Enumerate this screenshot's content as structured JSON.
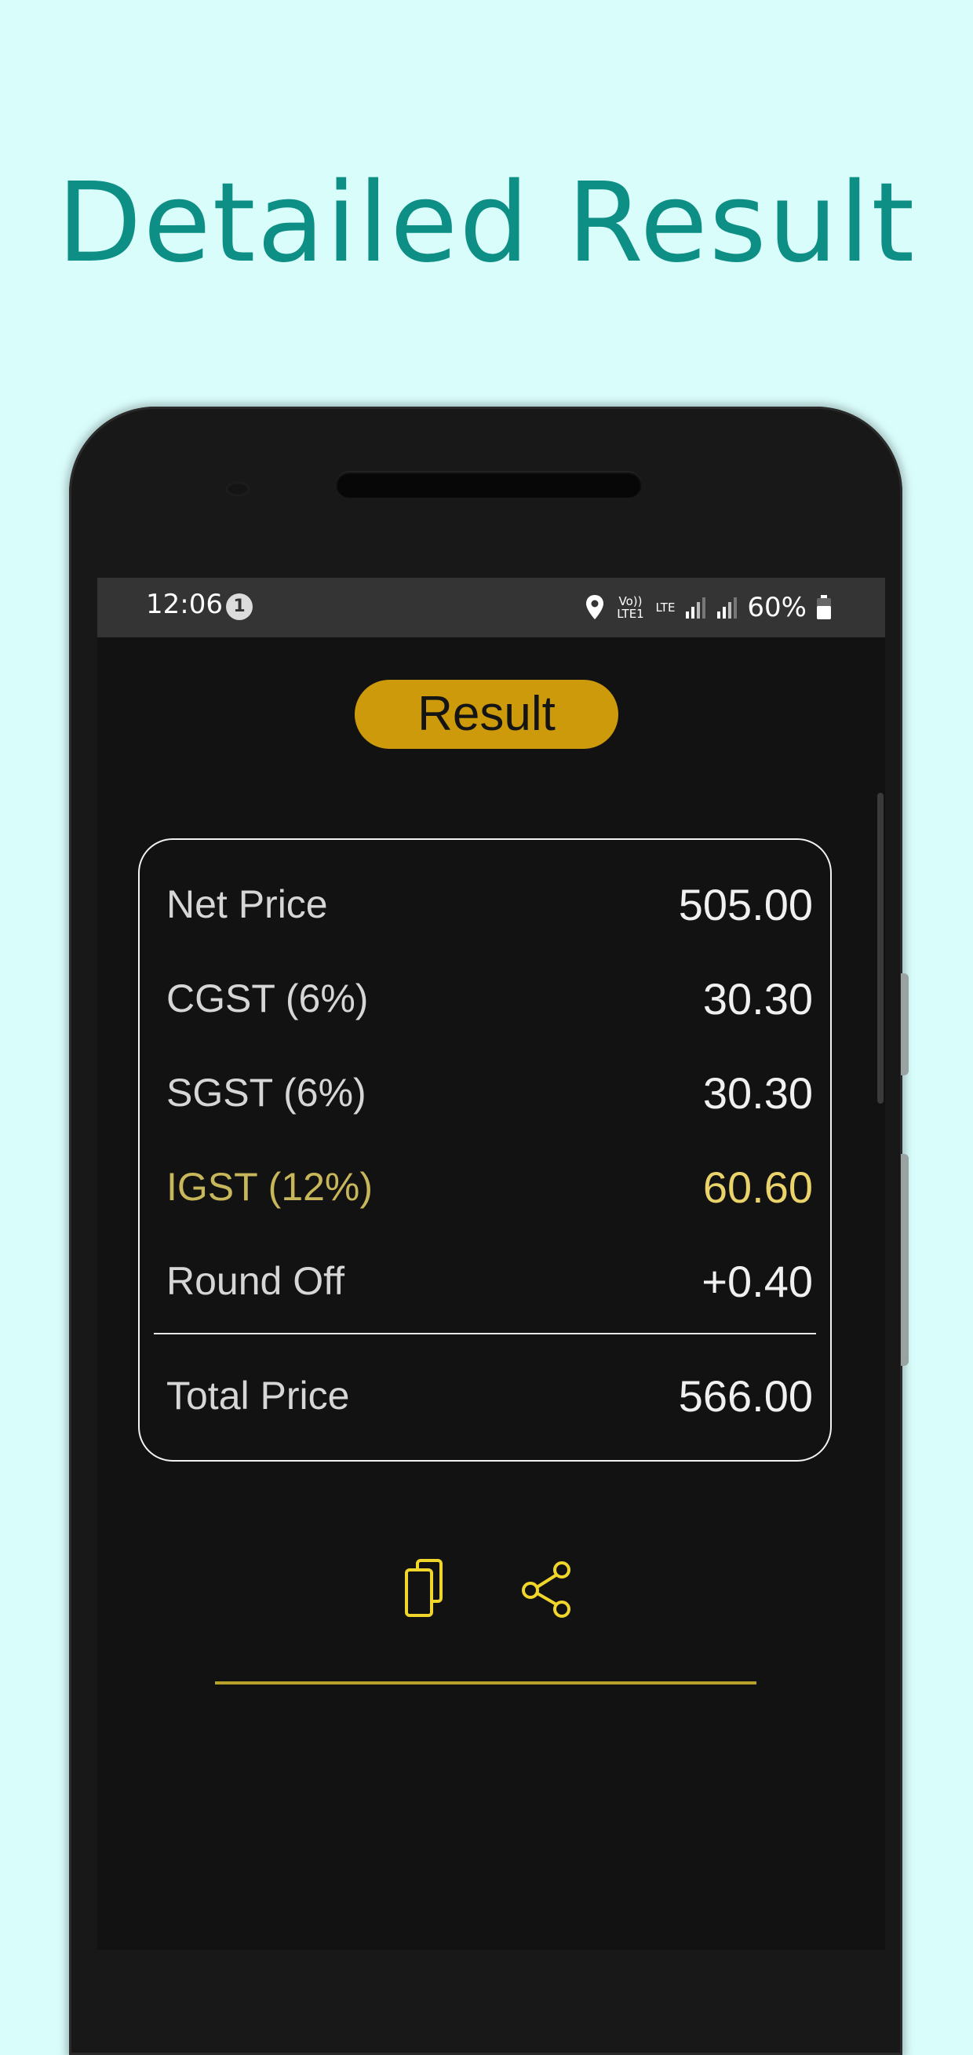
{
  "headline": "Detailed Result",
  "status_bar": {
    "time": "12:06",
    "notification_count": "1",
    "volte": "Vo)) LTE1",
    "lte": "LTE",
    "battery": "60%"
  },
  "result_button": "Result",
  "result_rows": [
    {
      "label": "Net Price",
      "value": "505.00"
    },
    {
      "label": "CGST (6%)",
      "value": "30.30"
    },
    {
      "label": "SGST (6%)",
      "value": "30.30"
    },
    {
      "label": "IGST (12%)",
      "value": "60.60"
    },
    {
      "label": "Round Off",
      "value": "+0.40"
    }
  ],
  "total": {
    "label": "Total Price",
    "value": "566.00"
  },
  "actions": {
    "copy_icon": "copy-icon",
    "share_icon": "share-icon"
  },
  "colors": {
    "background": "#d9fdfb",
    "headline": "#0e8f86",
    "screen": "#121212",
    "accent": "#cc9a0b",
    "highlight": "#ead36a"
  }
}
